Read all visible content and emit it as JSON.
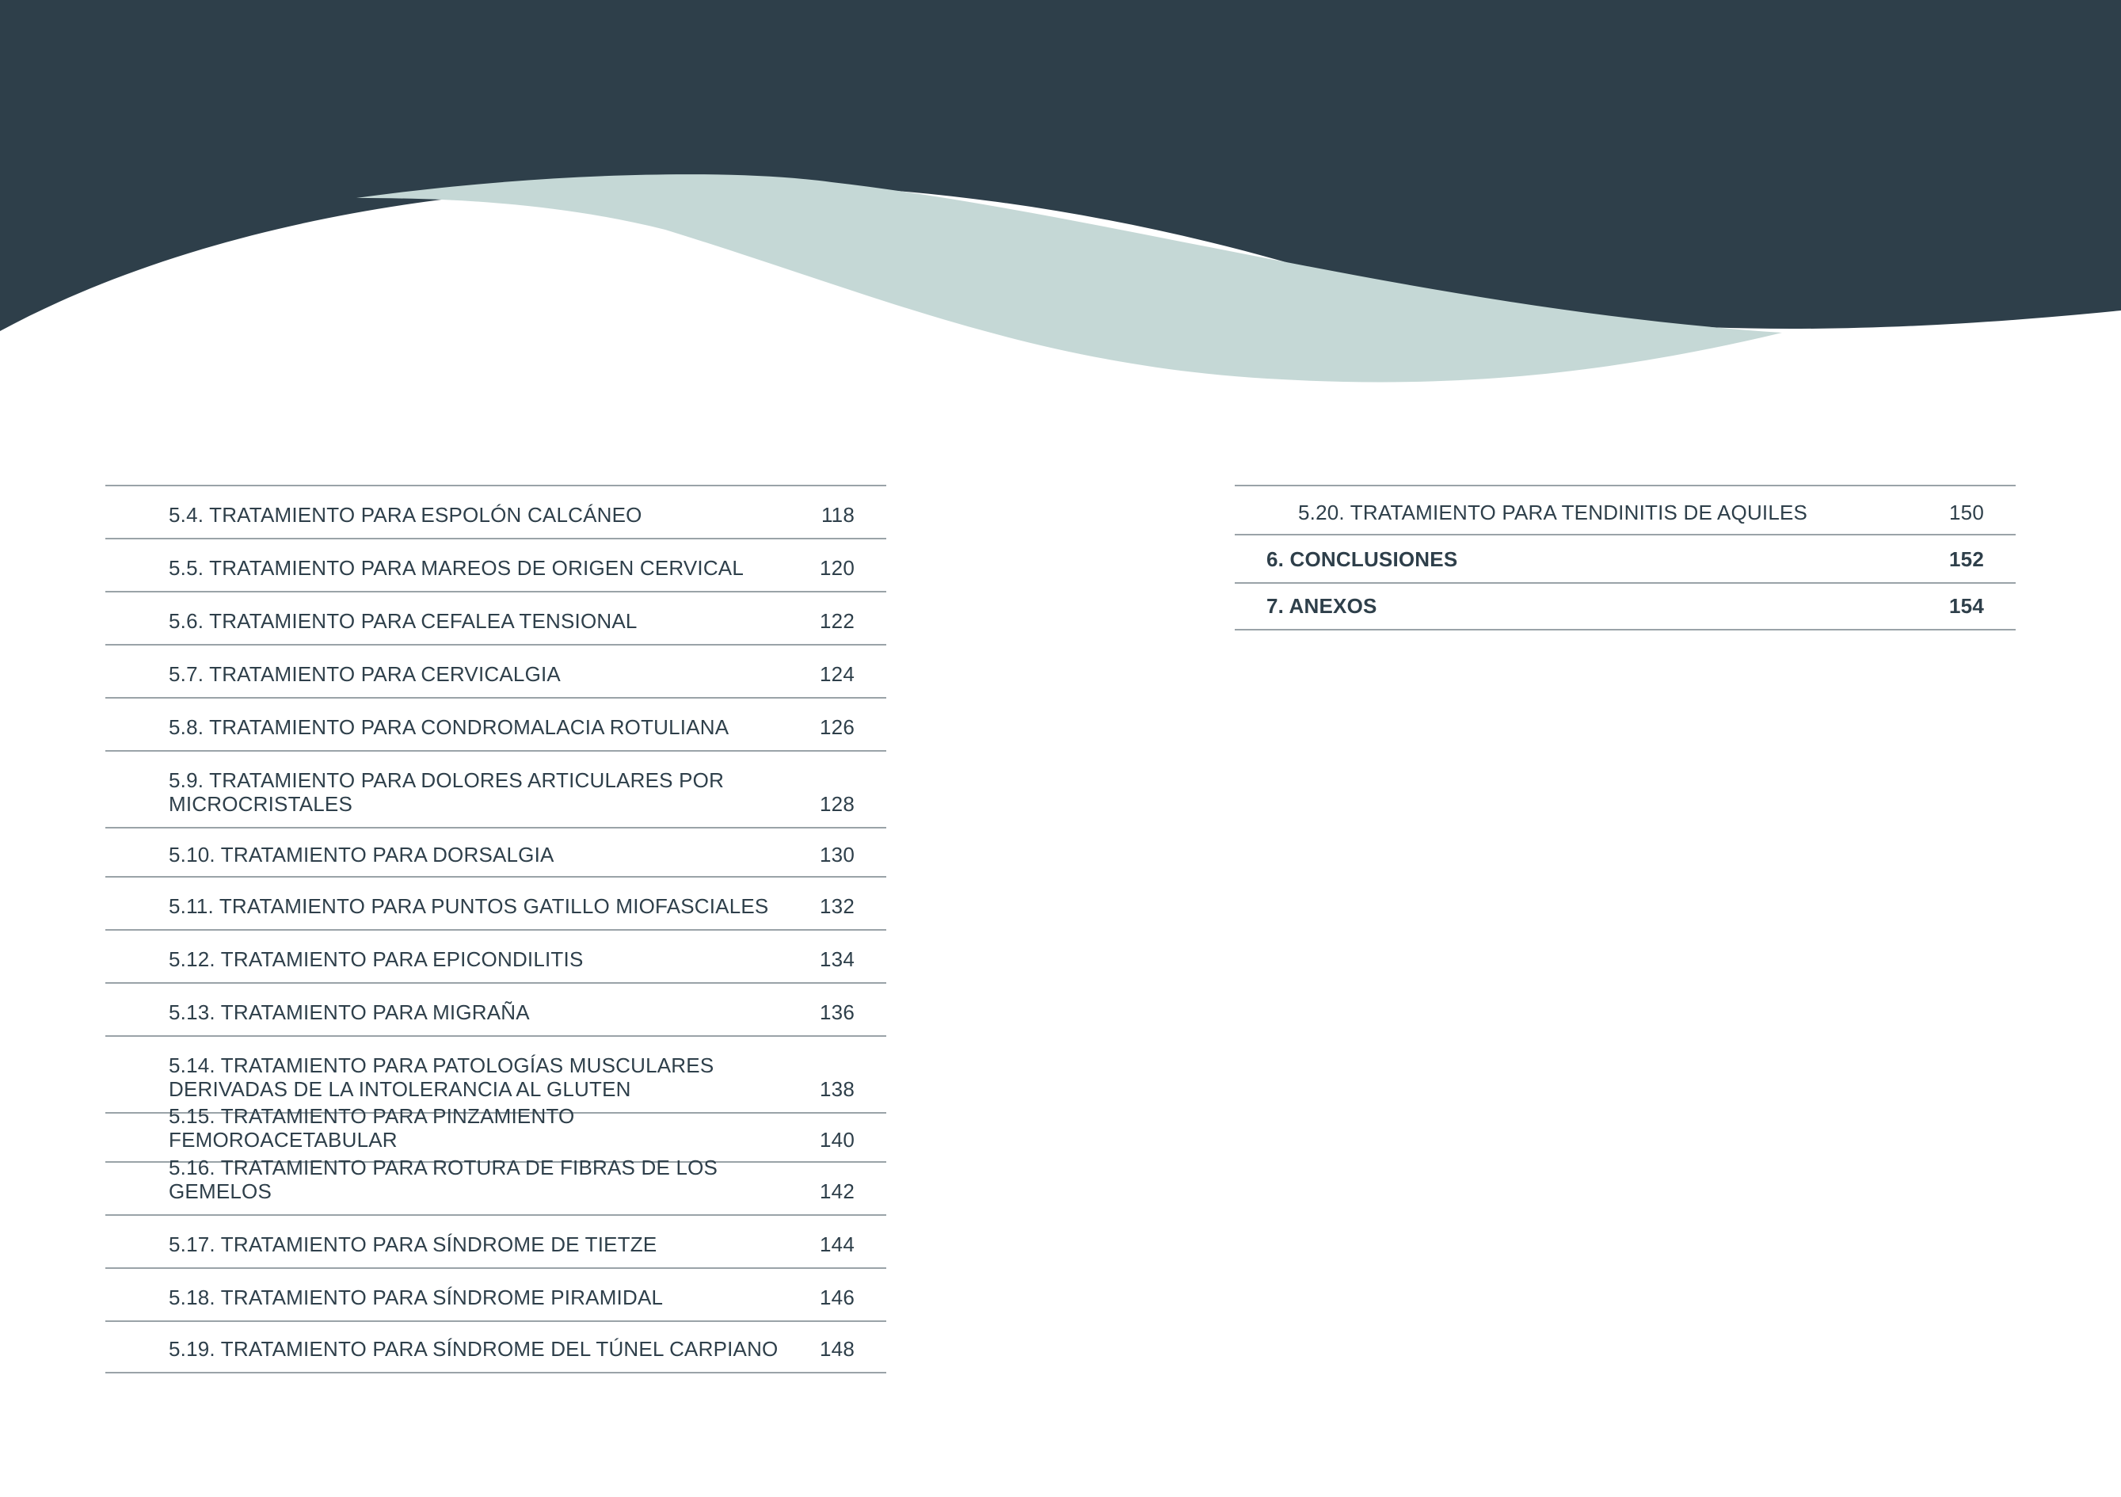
{
  "colors": {
    "dark": "#2e3f4a",
    "light": "#c5d8d6",
    "rule": "#9aa3a8"
  },
  "toc_left": [
    {
      "label": "5.4. TRATAMIENTO PARA ESPOLÓN CALCÁNEO",
      "page": "118"
    },
    {
      "label": "5.5. TRATAMIENTO PARA MAREOS DE ORIGEN CERVICAL",
      "page": "120"
    },
    {
      "label": "5.6. TRATAMIENTO PARA CEFALEA TENSIONAL",
      "page": "122"
    },
    {
      "label": "5.7. TRATAMIENTO PARA CERVICALGIA",
      "page": "124"
    },
    {
      "label": "5.8. TRATAMIENTO PARA CONDROMALACIA ROTULIANA",
      "page": "126"
    },
    {
      "label": "5.9. TRATAMIENTO PARA DOLORES ARTICULARES POR MICROCRISTALES",
      "page": "128"
    },
    {
      "label": "5.10. TRATAMIENTO PARA DORSALGIA",
      "page": "130"
    },
    {
      "label": "5.11. TRATAMIENTO PARA PUNTOS GATILLO MIOFASCIALES",
      "page": "132"
    },
    {
      "label": "5.12. TRATAMIENTO PARA EPICONDILITIS",
      "page": "134"
    },
    {
      "label": "5.13. TRATAMIENTO PARA MIGRAÑA",
      "page": "136"
    },
    {
      "label": "5.14. TRATAMIENTO PARA PATOLOGÍAS MUSCULARES DERIVADAS DE LA INTOLERANCIA AL GLUTEN",
      "page": "138"
    },
    {
      "label": "5.15. TRATAMIENTO PARA PINZAMIENTO FEMOROACETABULAR",
      "page": "140"
    },
    {
      "label": "5.16. TRATAMIENTO PARA ROTURA DE FIBRAS DE LOS GEMELOS",
      "page": "142"
    },
    {
      "label": "5.17. TRATAMIENTO PARA SÍNDROME DE TIETZE",
      "page": "144"
    },
    {
      "label": "5.18. TRATAMIENTO PARA SÍNDROME PIRAMIDAL",
      "page": "146"
    },
    {
      "label": "5.19. TRATAMIENTO PARA SÍNDROME DEL TÚNEL CARPIANO",
      "page": "148"
    }
  ],
  "toc_right": [
    {
      "label": "5.20. TRATAMIENTO PARA TENDINITIS DE AQUILES",
      "page": "150"
    },
    {
      "label": "6. CONCLUSIONES",
      "page": "152"
    },
    {
      "label": "7. ANEXOS",
      "page": "154"
    }
  ]
}
